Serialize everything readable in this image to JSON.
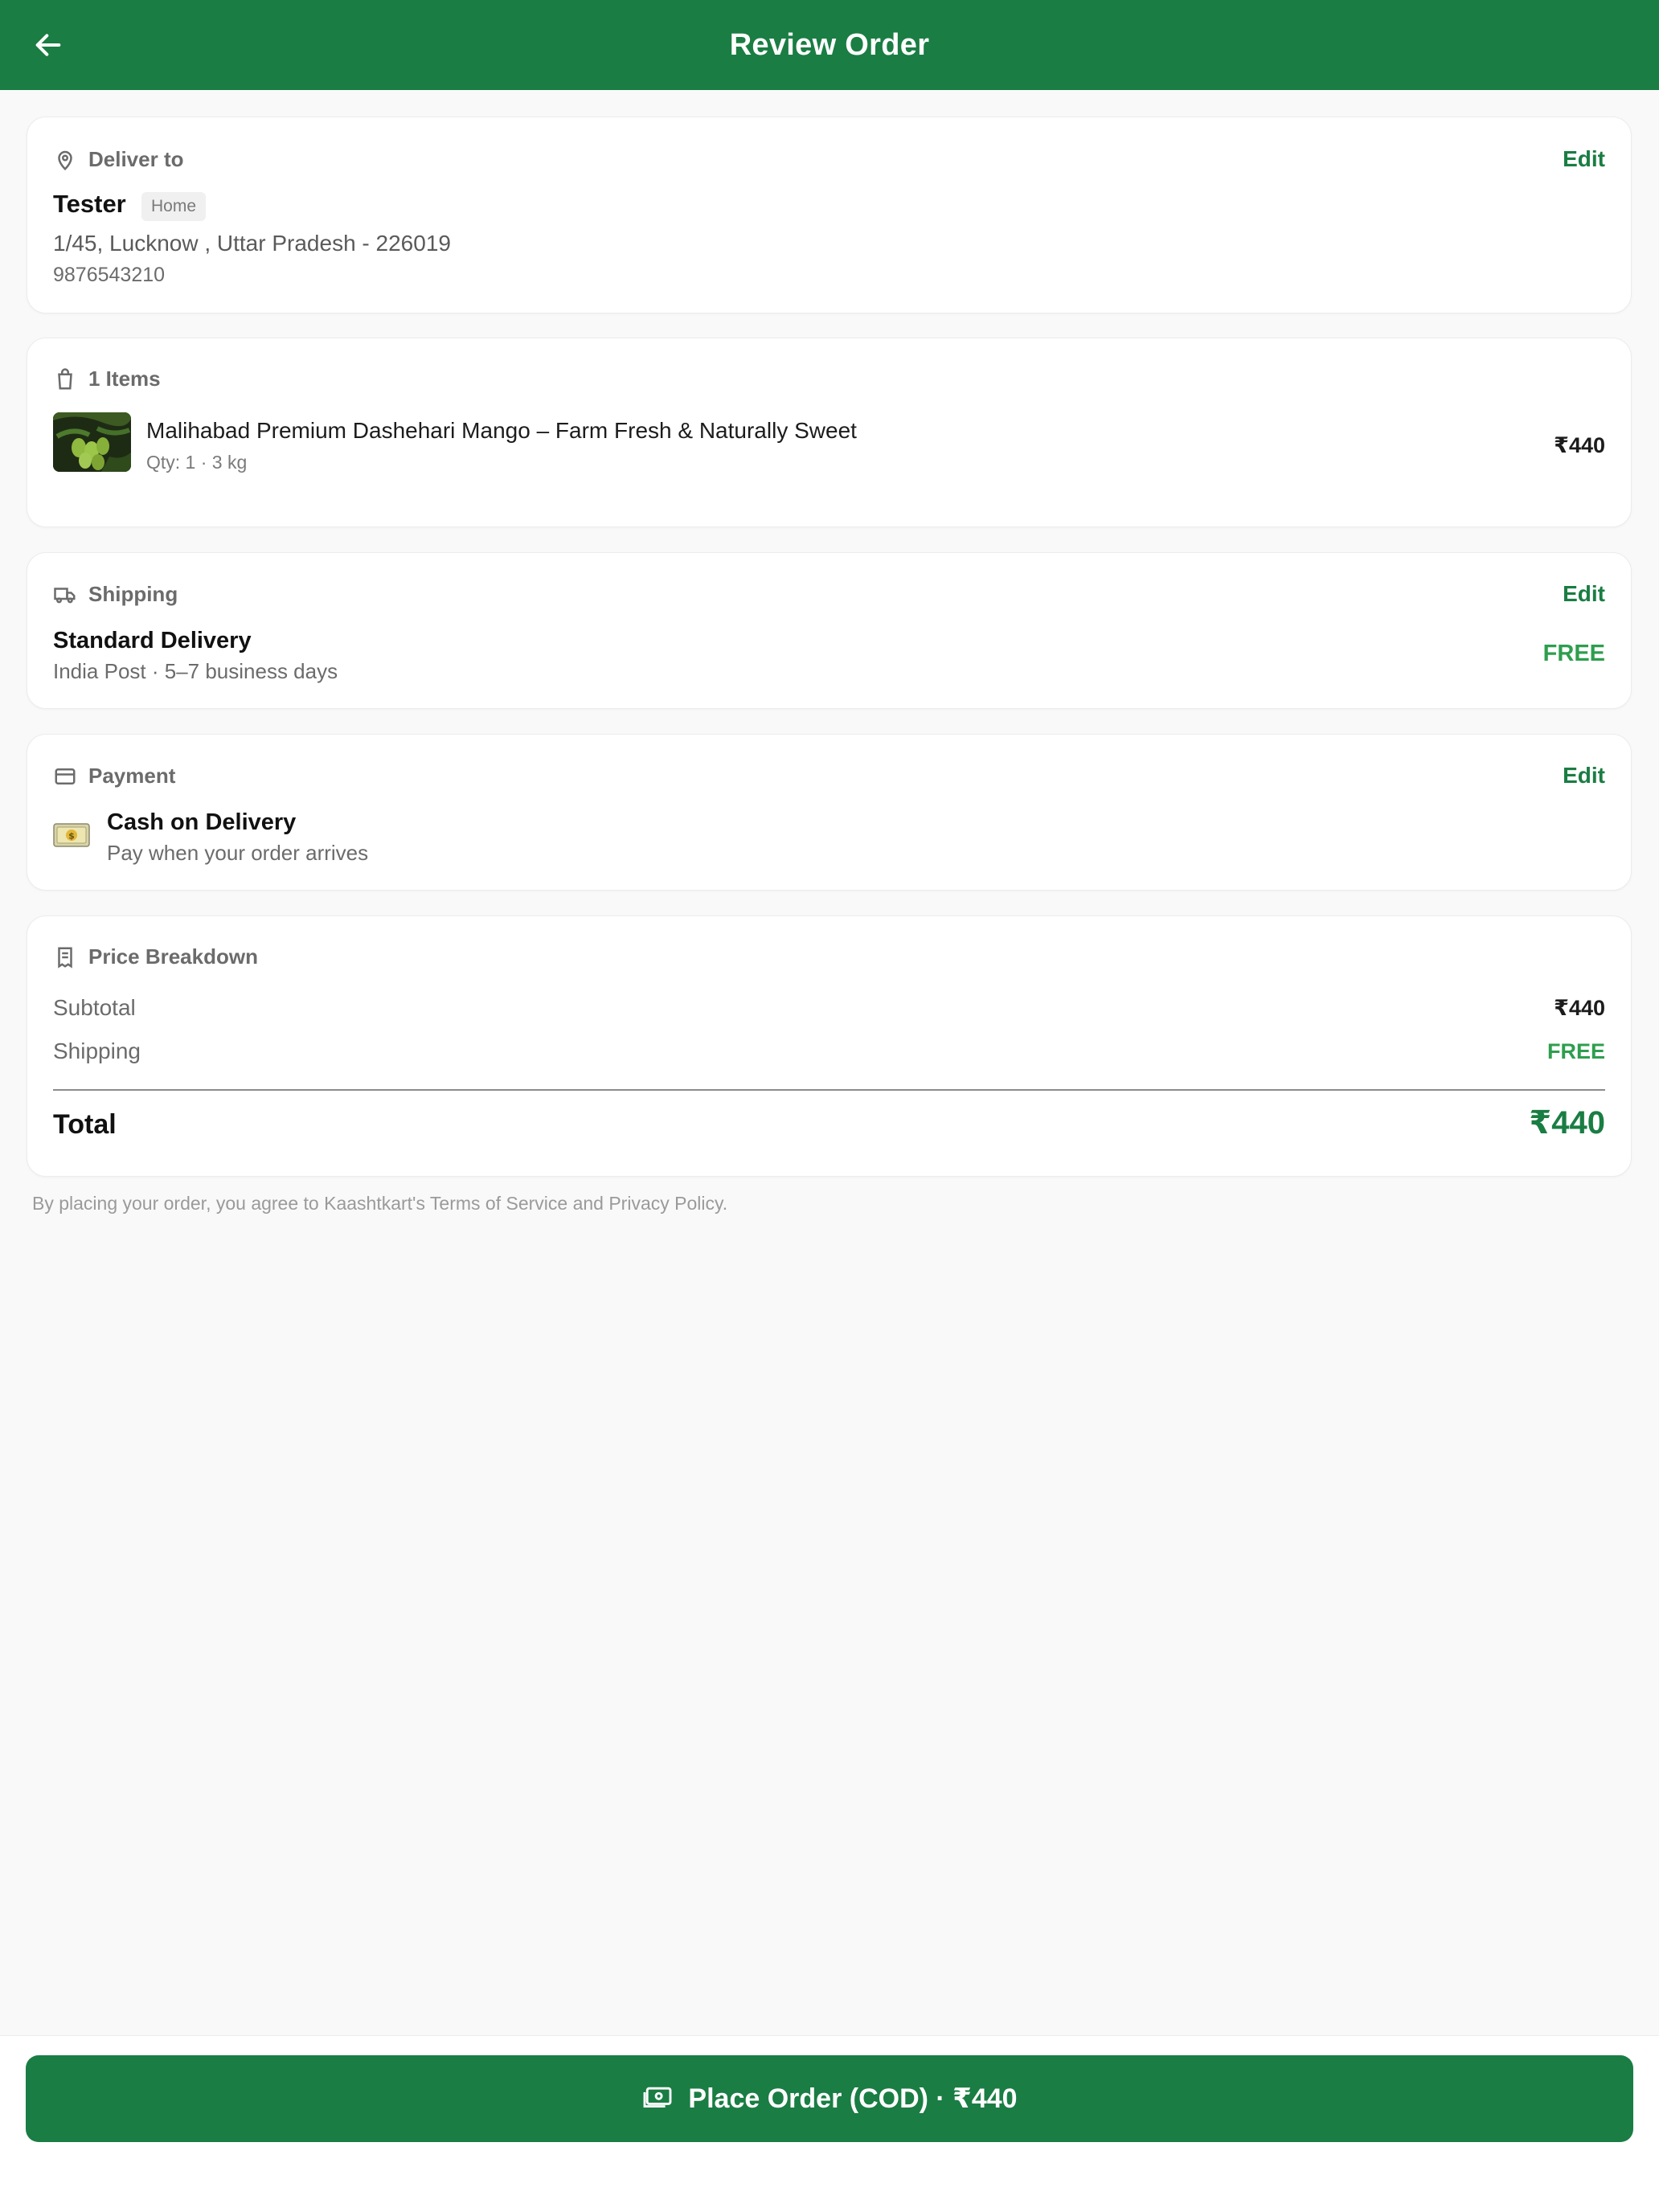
{
  "header": {
    "title": "Review Order",
    "back_icon": "arrow-left-icon"
  },
  "colors": {
    "primary": "#1a7d43",
    "free": "#2e9e4e",
    "background": "#f9f9f9"
  },
  "delivery": {
    "heading": "Deliver to",
    "edit_label": "Edit",
    "name": "Tester",
    "tag": "Home",
    "address": "1/45, Lucknow , Uttar Pradesh  - 226019",
    "phone": "9876543210"
  },
  "items": {
    "heading": "1 Items",
    "list": [
      {
        "name": "Malihabad Premium Dashehari Mango – Farm Fresh & Naturally Sweet",
        "meta": "Qty: 1  ·  3 kg",
        "price": "₹440"
      }
    ]
  },
  "shipping": {
    "heading": "Shipping",
    "edit_label": "Edit",
    "method": "Standard Delivery",
    "detail": "India Post · 5–7 business days",
    "price": "FREE"
  },
  "payment": {
    "heading": "Payment",
    "edit_label": "Edit",
    "method": "Cash on Delivery",
    "detail": "Pay when your order arrives"
  },
  "breakdown": {
    "heading": "Price Breakdown",
    "subtotal_label": "Subtotal",
    "subtotal_value": "₹440",
    "shipping_label": "Shipping",
    "shipping_value": "FREE",
    "total_label": "Total",
    "total_value": "₹440"
  },
  "terms": "By placing your order, you agree to Kaashtkart's Terms of Service and Privacy Policy.",
  "cta": {
    "label": "Place Order (COD) · ₹440"
  }
}
